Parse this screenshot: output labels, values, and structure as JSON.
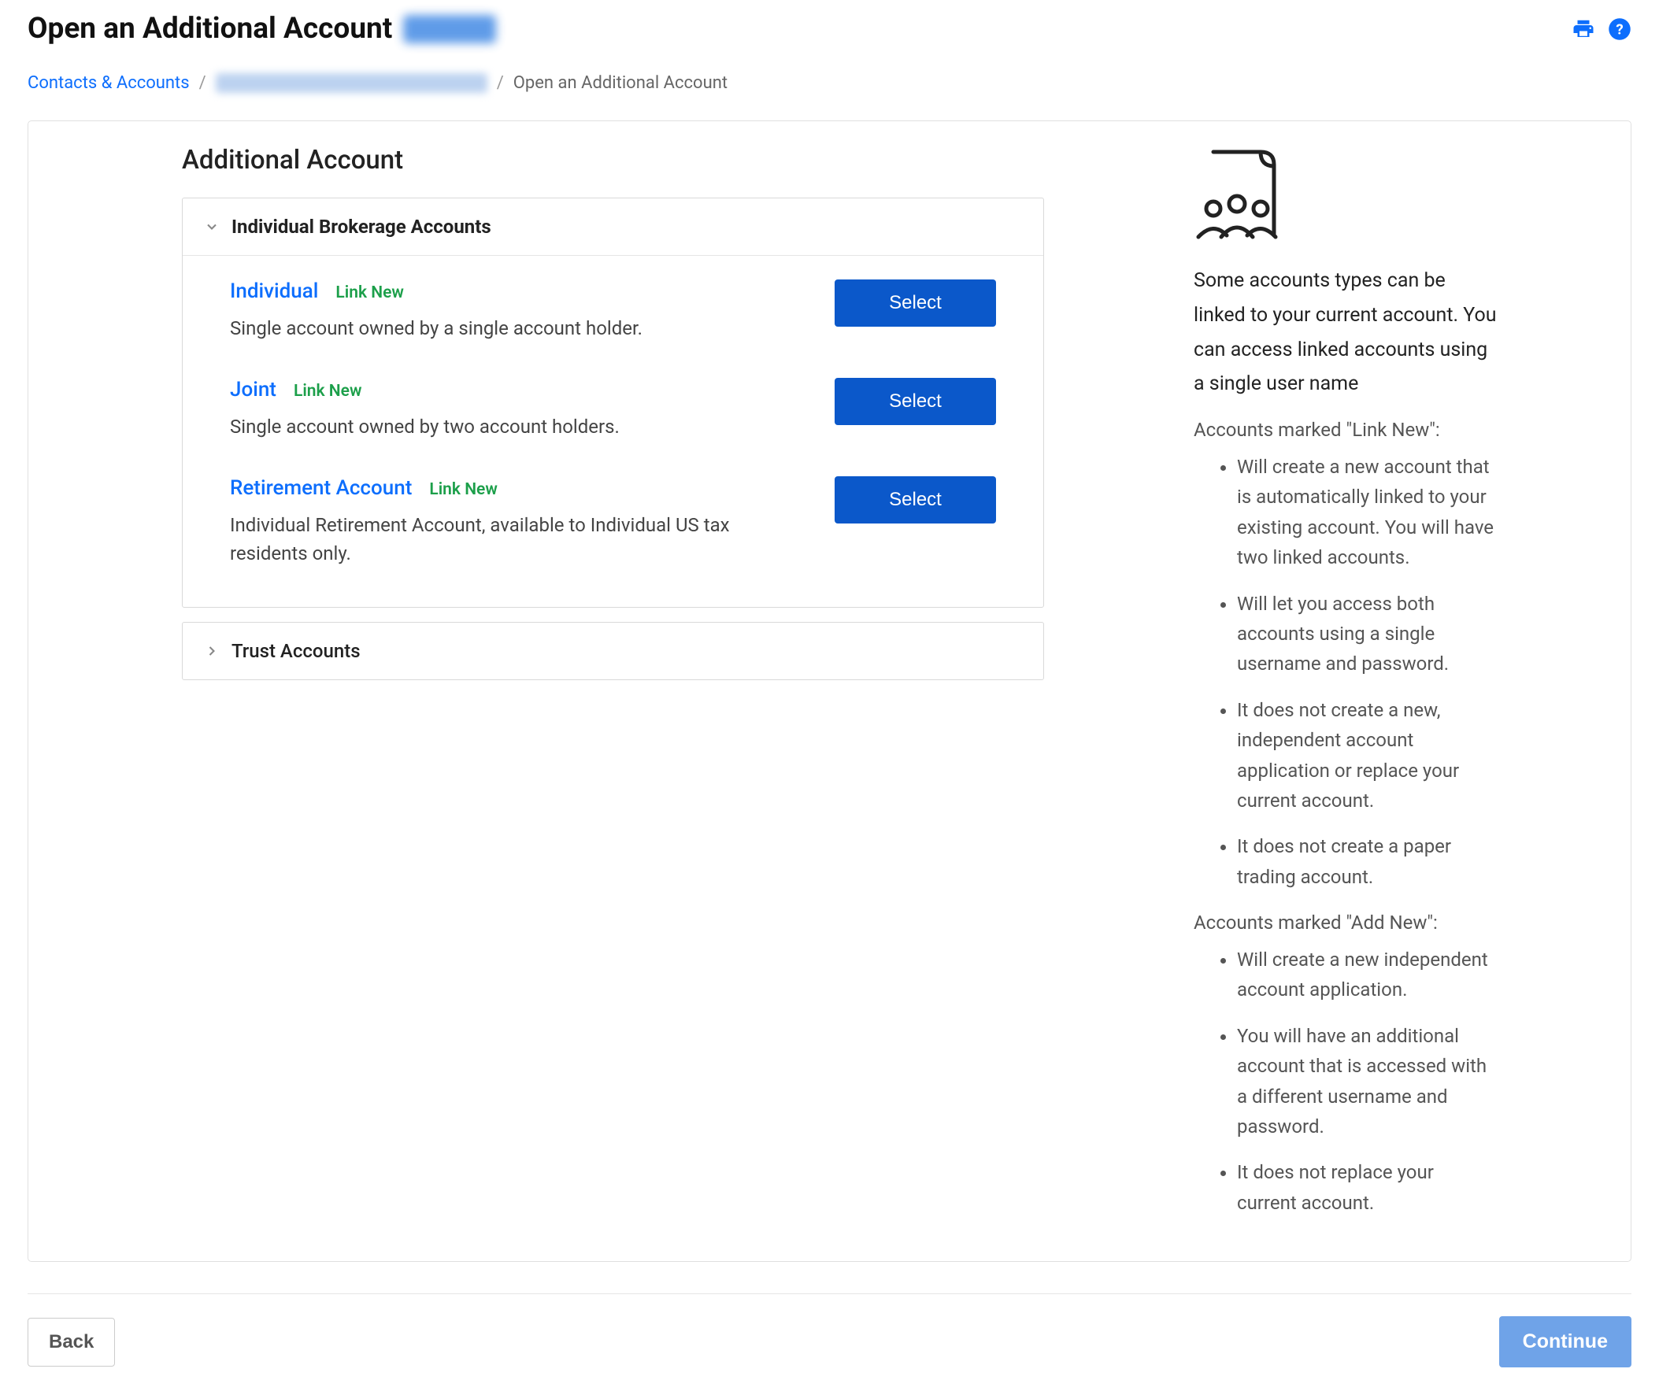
{
  "header": {
    "title": "Open an Additional Account"
  },
  "breadcrumb": {
    "root": "Contacts & Accounts",
    "current": "Open an Additional Account"
  },
  "section": {
    "title": "Additional Account"
  },
  "accordions": {
    "brokerage_label": "Individual Brokerage Accounts",
    "trust_label": "Trust Accounts"
  },
  "accounts": [
    {
      "title": "Individual",
      "tag": "Link New",
      "desc": "Single account owned by a single account holder.",
      "button": "Select"
    },
    {
      "title": "Joint",
      "tag": "Link New",
      "desc": "Single account owned by two account holders.",
      "button": "Select"
    },
    {
      "title": "Retirement Account",
      "tag": "Link New",
      "desc": "Individual Retirement Account, available to Individual US tax residents only.",
      "button": "Select"
    }
  ],
  "info": {
    "intro": "Some accounts types can be linked to your current account. You can access linked accounts using a single user name",
    "link_heading": "Accounts marked \"Link New\":",
    "link_bullets": [
      "Will create a new account that is automatically linked to your existing account. You will have two linked accounts.",
      "Will let you access both accounts using a single username and password.",
      "It does not create a new, independent account application or replace your current account.",
      "It does not create a paper trading account."
    ],
    "add_heading": "Accounts marked \"Add New\":",
    "add_bullets": [
      "Will create a new independent account application.",
      "You will have an additional account that is accessed with a different username and password.",
      "It does not replace your current account."
    ]
  },
  "footer": {
    "back": "Back",
    "continue": "Continue"
  }
}
